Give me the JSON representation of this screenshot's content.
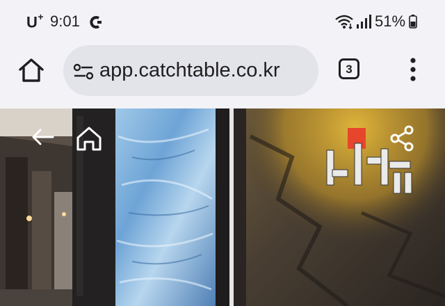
{
  "status_bar": {
    "carrier": "U",
    "carrier_plus": "+",
    "time": "9:01",
    "battery": "51%",
    "icons": [
      "app-notification-icon",
      "wifi-icon",
      "signal-icon",
      "battery-icon"
    ]
  },
  "browser": {
    "url": "app.catchtable.co.kr",
    "tab_count": "3",
    "icons": [
      "home-icon",
      "site-settings-icon",
      "more-vert-icon"
    ]
  },
  "page": {
    "icons": [
      "back-arrow-icon",
      "home-icon",
      "share-icon"
    ],
    "colors": {
      "sign_accent": "#e7462c",
      "wall_light": "#d8a624"
    }
  }
}
